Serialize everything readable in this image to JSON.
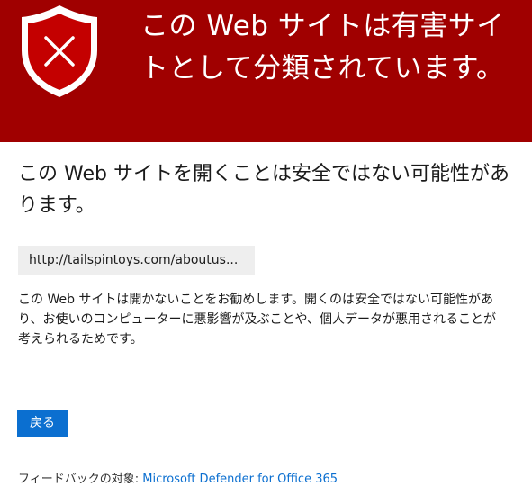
{
  "banner": {
    "icon": "shield-x-icon",
    "title": "この Web サイトは有害サイトとして分類されています。",
    "color": "#a00000"
  },
  "main": {
    "heading": "この Web サイトを開くことは安全ではない可能性があります。",
    "url": "http://tailspintoys.com/aboutus...",
    "description": "この Web サイトは開かないことをお勧めします。開くのは安全ではない可能性があり、お使いのコンピューターに悪影響が及ぶことや、個人データが悪用されることが考えられるためです。",
    "back_label": "戻る"
  },
  "footer": {
    "feedback_prefix": "フィードバックの対象: ",
    "feedback_link": "Microsoft Defender for Office 365"
  },
  "colors": {
    "banner": "#a00000",
    "button": "#0b6fd0",
    "link": "#0b6fd0"
  }
}
